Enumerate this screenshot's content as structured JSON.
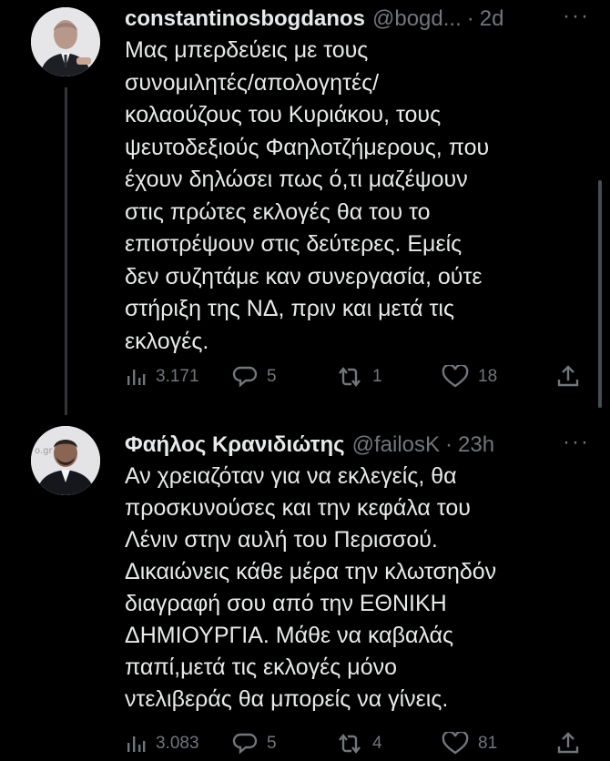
{
  "tweets": [
    {
      "name": "constantinosbogdanos",
      "handle": "@bogd...",
      "time": "2d",
      "text": [
        "Μας μπερδεύεις με τους",
        "συνομιλητές/απολογητές/",
        "κολαούζους του Κυριάκου, τους",
        "ψευτοδεξιούς Φαηλοτζήμερους, που",
        "έχουν δηλώσει πως ό,τι μαζέψουν",
        "στις πρώτες εκλογές θα του το",
        "επιστρέψουν στις δεύτερες. Εμείς",
        "δεν συζητάμε καν συνεργασία, ούτε",
        "στήριξη της ΝΔ, πριν και μετά τις",
        "εκλογές."
      ],
      "views": "3.171",
      "replies": "5",
      "retweets": "1",
      "likes": "18"
    },
    {
      "name": "Φαήλος Κρανιδιώτης",
      "handle": "@failosK",
      "time": "23h",
      "text": [
        "Αν χρειαζόταν για να εκλεγείς, θα",
        "προσκυνούσες και την κεφάλα του",
        "Λένιν στην αυλή του Περισσού.",
        "Δικαιώνεις κάθε μέρα την κλωτσηδόν",
        "διαγραφή σου από την ΕΘΝΙΚΗ",
        "ΔΗΜΙΟΥΡΓΙΑ. Μάθε να καβαλάς",
        "παπί,μετά τις εκλογές μόνο",
        "ντελιβεράς θα μπορείς να γίνεις."
      ],
      "views": "3.083",
      "replies": "5",
      "retweets": "4",
      "likes": "81",
      "avatar_watermark": "o.gr"
    }
  ],
  "separator": "·",
  "more_glyph": "···"
}
